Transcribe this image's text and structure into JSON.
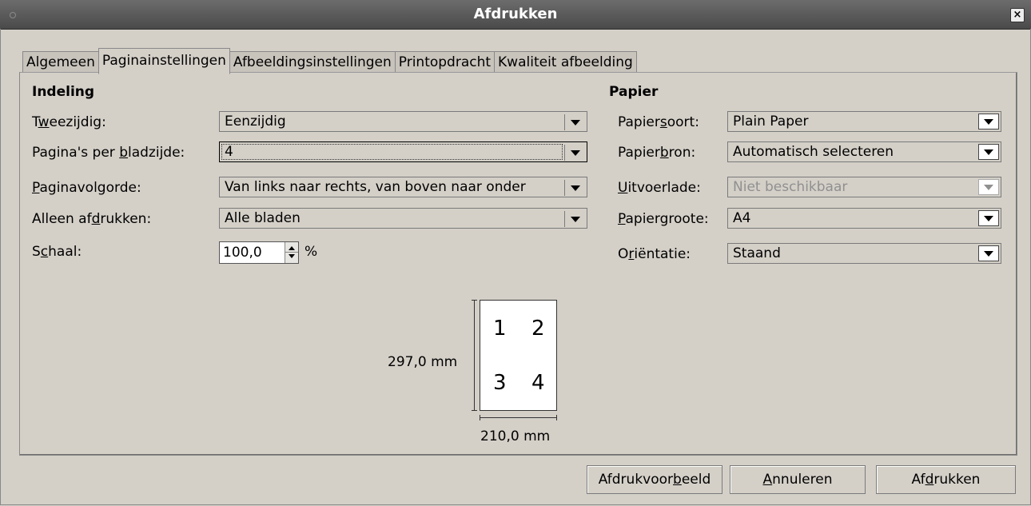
{
  "window": {
    "title": "Afdrukken",
    "close_glyph": "×"
  },
  "tabs": [
    {
      "label": "Algemeen",
      "active": false
    },
    {
      "label": "Paginainstellingen",
      "active": true
    },
    {
      "label": "Afbeeldingsinstellingen",
      "active": false
    },
    {
      "label": "Printopdracht",
      "active": false
    },
    {
      "label": "Kwaliteit afbeelding",
      "active": false
    }
  ],
  "layout_section": {
    "title": "Indeling",
    "two_sided": {
      "label_pre": "T",
      "label_u": "w",
      "label_post": "eezijdig:",
      "value": "Eenzijdig"
    },
    "pages_per_side": {
      "label_pre": "Pagina's per ",
      "label_u": "b",
      "label_post": "ladzijde:",
      "value": "4"
    },
    "page_order": {
      "label_pre": "",
      "label_u": "P",
      "label_post": "aginavolgorde:",
      "value": "Van links naar rechts, van boven naar onder"
    },
    "only_print": {
      "label_pre": "Alleen af",
      "label_u": "d",
      "label_post": "rukken:",
      "value": "Alle bladen"
    },
    "scale": {
      "label_pre": "S",
      "label_u": "c",
      "label_post": "haal:",
      "value": "100,0",
      "unit": "%"
    }
  },
  "paper_section": {
    "title": "Papier",
    "paper_type": {
      "label_pre": "Papier",
      "label_u": "s",
      "label_post": "oort:",
      "value": "Plain Paper"
    },
    "paper_source": {
      "label_pre": "Papier",
      "label_u": "b",
      "label_post": "ron:",
      "value": "Automatisch selecteren"
    },
    "output_tray": {
      "label_pre": "",
      "label_u": "U",
      "label_post": "itvoerlade:",
      "value": "Niet beschikbaar",
      "disabled": true
    },
    "paper_size": {
      "label_pre": "",
      "label_u": "P",
      "label_post": "apiergroote:",
      "value": "A4"
    },
    "orientation": {
      "label_pre": "O",
      "label_u": "r",
      "label_post": "iëntatie:",
      "value": "Staand"
    }
  },
  "preview": {
    "height_label": "297,0 mm",
    "width_label": "210,0 mm",
    "page_numbers": [
      "1",
      "2",
      "3",
      "4"
    ]
  },
  "buttons": {
    "preview": {
      "pre": "Afdrukvoor",
      "u": "b",
      "post": "eeld"
    },
    "cancel": {
      "pre": "",
      "u": "A",
      "post": "nnuleren"
    },
    "print": {
      "pre": "Af",
      "u": "d",
      "post": "rukken"
    }
  }
}
